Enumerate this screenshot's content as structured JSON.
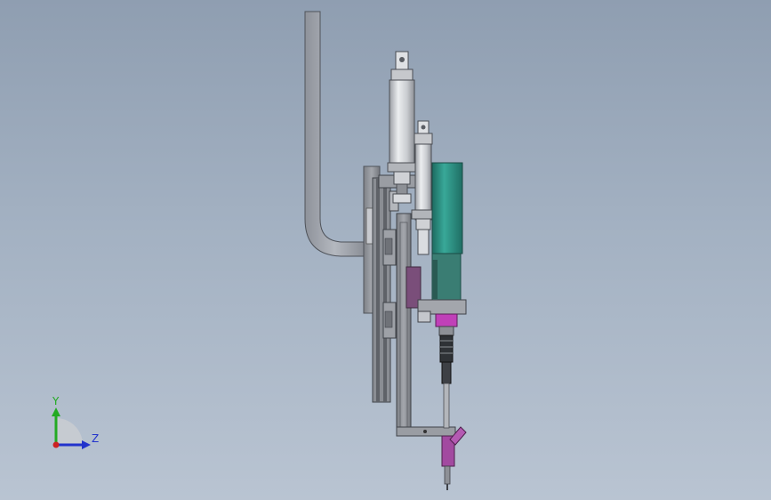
{
  "viewport": {
    "background_top": "#8f9eb1",
    "background_bottom": "#b9c4d2"
  },
  "model": {
    "description_icons": [
      "hose-icon",
      "cylinder-icon",
      "motor-icon",
      "nozzle-icon",
      "rail-icon"
    ],
    "colors": {
      "metal_light": "#d4d6da",
      "metal_mid": "#9fa2a8",
      "metal_dark": "#6b6e74",
      "frame": "#8a8d93",
      "motor": "#2f9a8c",
      "motor_dark": "#1f6e64",
      "accent_magenta": "#c040b8",
      "accent_purple": "#7a4e7a",
      "hose": "#a8acb4"
    }
  },
  "triad": {
    "y_label": "Y",
    "z_label": "Z",
    "y_color": "#22aa22",
    "z_color": "#2233cc",
    "x_color": "#cc2222"
  }
}
